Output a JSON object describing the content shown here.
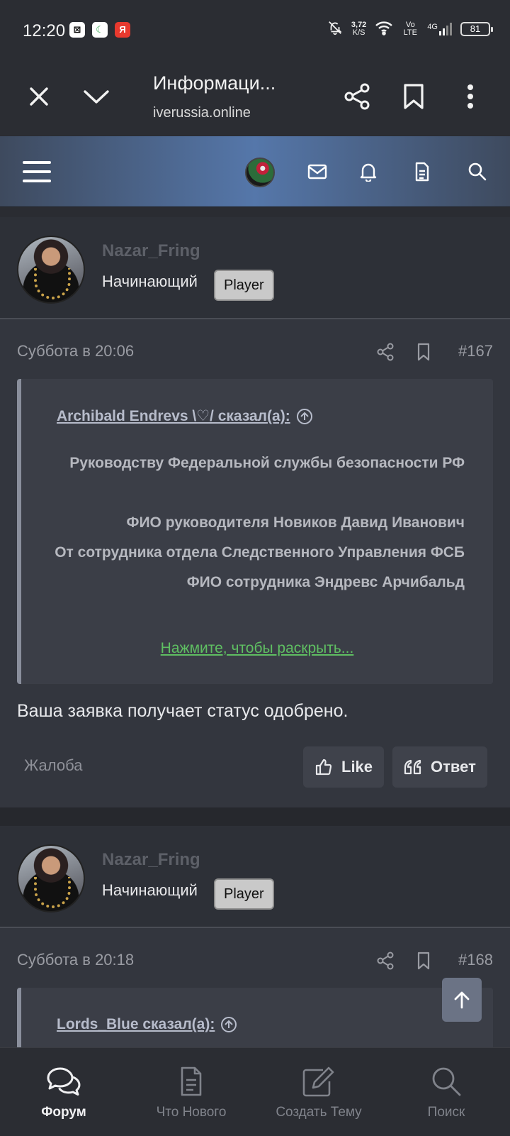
{
  "status_bar": {
    "time": "12:20",
    "apps": [
      "capcut-icon",
      "whatsapp-icon",
      "yandex-icon"
    ],
    "net_speed": "3,72",
    "net_unit": "K/S",
    "volte": "Vo LTE",
    "network": "4G",
    "battery": "81"
  },
  "browser": {
    "title": "Информаци...",
    "url": "iverussia.online"
  },
  "posts": [
    {
      "author": "Nazar_Fring",
      "rank": "Начинающий",
      "badge": "Player",
      "date": "Суббота в 20:06",
      "number": "#167",
      "quote": {
        "author": "Archibald Endrevs \\♡/ сказал(а):",
        "lines": [
          "Руководству Федеральной службы безопасности РФ",
          "ФИО руководителя Новиков Давид Иванович",
          "От сотрудника отдела Следственного Управления ФСБ",
          "ФИО сотрудника Эндревс Арчибальд"
        ],
        "expand": "Нажмите, чтобы раскрыть..."
      },
      "text": "Ваша заявка получает статус одобрено.",
      "report": "Жалоба",
      "like": "Like",
      "reply": "Ответ"
    },
    {
      "author": "Nazar_Fring",
      "rank": "Начинающий",
      "badge": "Player",
      "date": "Суббота в 20:18",
      "number": "#168",
      "quote": {
        "author": "Lords_Blue сказал(а):"
      }
    }
  ],
  "tabs": [
    {
      "label": "Форум",
      "icon": "forum-icon",
      "active": true
    },
    {
      "label": "Что Нового",
      "icon": "document-icon",
      "active": false
    },
    {
      "label": "Создать Тему",
      "icon": "edit-icon",
      "active": false
    },
    {
      "label": "Поиск",
      "icon": "search-icon",
      "active": false
    }
  ]
}
